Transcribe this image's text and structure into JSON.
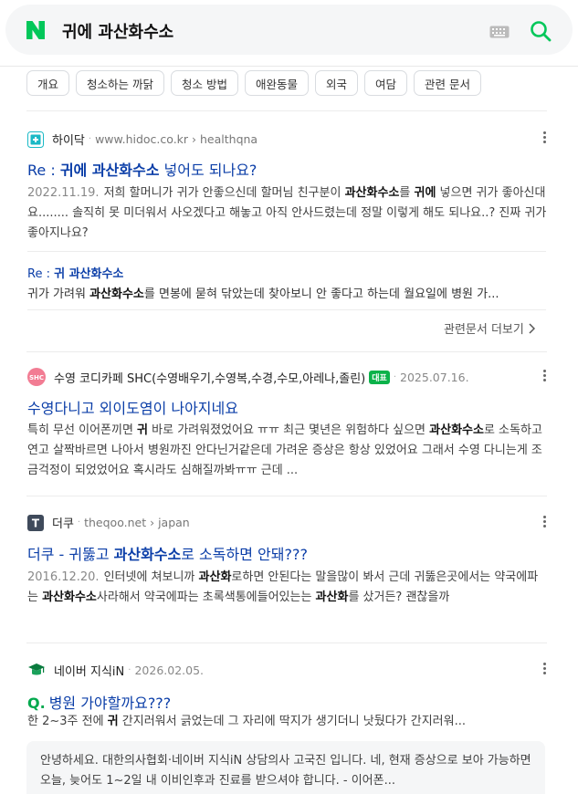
{
  "search": {
    "query": "귀에 과산화수소"
  },
  "chips": [
    "개요",
    "청소하는 까닭",
    "청소 방법",
    "애완동물",
    "외국",
    "여담",
    "관련 문서"
  ],
  "results": [
    {
      "site": "하이닥",
      "url": "www.hidoc.co.kr › healthqna",
      "title_pre": "Re : ",
      "title_hl": "귀에 과산화수소",
      "title_post": " 넣어도 되나요?",
      "date": "2022.11.19.",
      "desc_a": "저희 할머니가 귀가 안좋으신데 할머님 친구분이 ",
      "desc_hl1": "과산화수소",
      "desc_b": "를 ",
      "desc_hl2": "귀에",
      "desc_c": " 넣으면 귀가 좋아신대요........ 솔직히 못 미더워서 사오겠다고 해놓고 아직 안사드렸는데 정말 이렇게 해도 되나요..? 진짜 귀가 좋아지나요?",
      "sub_pre": "Re : ",
      "sub_hl": "귀 과산화수소",
      "sub_desc_a": "귀가 가려워 ",
      "sub_desc_hl": "과산화수소",
      "sub_desc_b": "를 면봉에 묻혀 닦았는데 찾아보니 안 좋다고 하는데 월요일에 병원 가...",
      "related": "관련문서 더보기"
    },
    {
      "site": "수영 코디카페 SHC(수영배우기,수영복,수경,수모,아레나,졸린)",
      "avatar": "SHC",
      "badge": "대표",
      "date": "2025.07.16.",
      "title": "수영다니고 외이도염이 나아지네요",
      "desc_a": "특히 무선 이어폰끼면 ",
      "desc_hl1": "귀",
      "desc_b": " 바로 가려워졌었어요 ㅠㅠ 최근 몇년은 위험하다 싶으면 ",
      "desc_hl2": "과산화수소",
      "desc_c": "로 소독하고 연고 살짝바르면 나아서 병원까진 안다닌거같은데 가려운 증상은 항상 있었어요 그래서 수영 다니는게 조금걱정이 되었었어요 혹시라도 심해질까봐ㅠㅠ 근데 ..."
    },
    {
      "site": "더쿠",
      "url": "theqoo.net › japan",
      "title_pre": "더쿠 - 귀뚫고 ",
      "title_hl": "과산화수소",
      "title_post": "로 소독하면 안돼???",
      "date": "2016.12.20.",
      "desc_a": "인터넷에 쳐보니까 ",
      "desc_hl1": "과산화",
      "desc_b": "로하면 안된다는 말을많이 봐서 근데 귀뚫은곳에서는 약국에파는 ",
      "desc_hl2": "과산화수소",
      "desc_c": "사라해서 약국에파는 초록색통에들어있는는 ",
      "desc_hl3": "과산화",
      "desc_d": "를 샀거든? 괜찮을까"
    },
    {
      "site": "네이버 지식iN",
      "date": "2026.02.05.",
      "q_mark": "Q.",
      "title": "병원 가야할까요???",
      "desc_a": "한 2~3주 전에 ",
      "desc_hl1": "귀",
      "desc_b": " 간지러워서 긁었는데 그 자리에 딱지가 생기더니 낫뒀다가 간지러워...",
      "answer": "안녕하세요. 대한의사협회·네이버 지식iN 상담의사 고국진 입니다. 네, 현재 증상으로 보아 가능하면 오늘, 늦어도 1~2일 내 이비인후과 진료를 받으셔야 합니다. - 이어폰..."
    }
  ]
}
